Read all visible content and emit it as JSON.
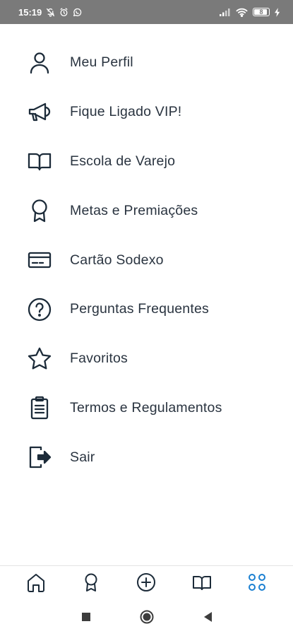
{
  "status_bar": {
    "time": "15:19",
    "battery_level": "8",
    "colors": {
      "background": "#7a7a7a",
      "foreground": "#ffffff"
    },
    "icons": [
      "notification-off-icon",
      "alarm-icon",
      "whatsapp-icon",
      "signal-icon",
      "wifi-icon",
      "battery-icon",
      "charging-icon"
    ]
  },
  "menu": {
    "items": [
      {
        "label": "Meu Perfil",
        "icon": "user-icon"
      },
      {
        "label": "Fique Ligado VIP!",
        "icon": "megaphone-icon"
      },
      {
        "label": "Escola de Varejo",
        "icon": "book-icon"
      },
      {
        "label": "Metas e Premiações",
        "icon": "award-icon"
      },
      {
        "label": "Cartão Sodexo",
        "icon": "credit-card-icon"
      },
      {
        "label": "Perguntas Frequentes",
        "icon": "help-circle-icon"
      },
      {
        "label": "Favoritos",
        "icon": "star-icon"
      },
      {
        "label": "Termos e Regulamentos",
        "icon": "clipboard-icon"
      },
      {
        "label": "Sair",
        "icon": "logout-icon"
      }
    ]
  },
  "bottom_nav": {
    "items": [
      {
        "icon": "home-icon",
        "active": false
      },
      {
        "icon": "award-icon",
        "active": false
      },
      {
        "icon": "plus-circle-icon",
        "active": false
      },
      {
        "icon": "book-icon",
        "active": false
      },
      {
        "icon": "menu-grid-icon",
        "active": true
      }
    ],
    "colors": {
      "inactive": "#1c2b39",
      "active": "#1a7fd1"
    }
  },
  "system_nav": {
    "icons": [
      "recents-icon",
      "home-circle-icon",
      "back-icon"
    ]
  }
}
